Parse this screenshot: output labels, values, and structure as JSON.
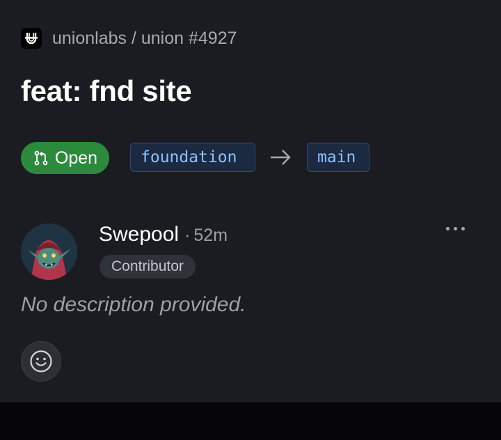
{
  "header": {
    "repo": "unionlabs / union #4927",
    "logo_icon": "union-logo-icon"
  },
  "pull_request": {
    "title": "feat: fnd site",
    "status": "Open",
    "status_icon": "git-pull-request-icon",
    "status_color": "#2c8a3c",
    "head_branch": "foundation",
    "base_branch": "main",
    "arrow_icon": "arrow-right-icon"
  },
  "comment": {
    "author": "Swepool",
    "separator": "·",
    "time": "52m",
    "role": "Contributor",
    "avatar": "goblin-avatar",
    "more_icon": "more-horizontal-icon",
    "body": "No description provided.",
    "reaction_icon": "smiley-icon"
  },
  "colors": {
    "background": "#1b1c21",
    "branch_bg": "#1b2a41",
    "branch_text": "#8cc0ff"
  }
}
